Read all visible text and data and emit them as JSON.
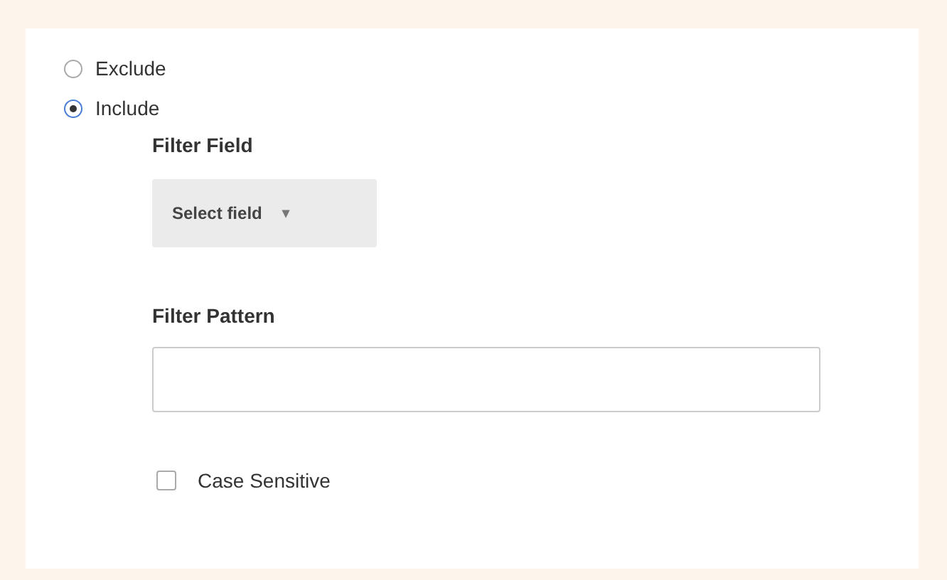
{
  "filter_type": [
    {
      "label": "Exclude",
      "selected": false
    },
    {
      "label": "Include",
      "selected": true
    }
  ],
  "filter_field": {
    "label": "Filter Field",
    "button": "Select field",
    "caret": "▾"
  },
  "filter_pattern": {
    "label": "Filter Pattern"
  },
  "case_sensitive": {
    "label": "Case Sensitive",
    "checked": false
  }
}
